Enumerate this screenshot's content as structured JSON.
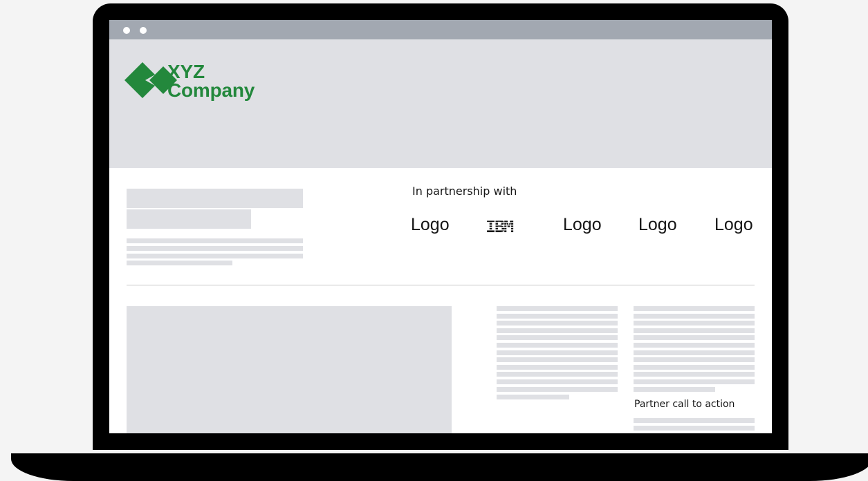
{
  "brand": {
    "name_line1": "XYZ",
    "name_line2": "Company",
    "color": "#23883c"
  },
  "partners": {
    "label": "In partnership with",
    "logos": [
      "Logo",
      "IBM",
      "Logo",
      "Logo",
      "Logo"
    ]
  },
  "partner_cta": "Partner call to action",
  "colors": {
    "placeholder": "#dfe0e4",
    "titlebar": "#a2a8b1",
    "frame": "#000000"
  },
  "icons": [
    "window-dot-icon",
    "xyz-diamond-logo-icon",
    "ibm-logo-icon"
  ]
}
